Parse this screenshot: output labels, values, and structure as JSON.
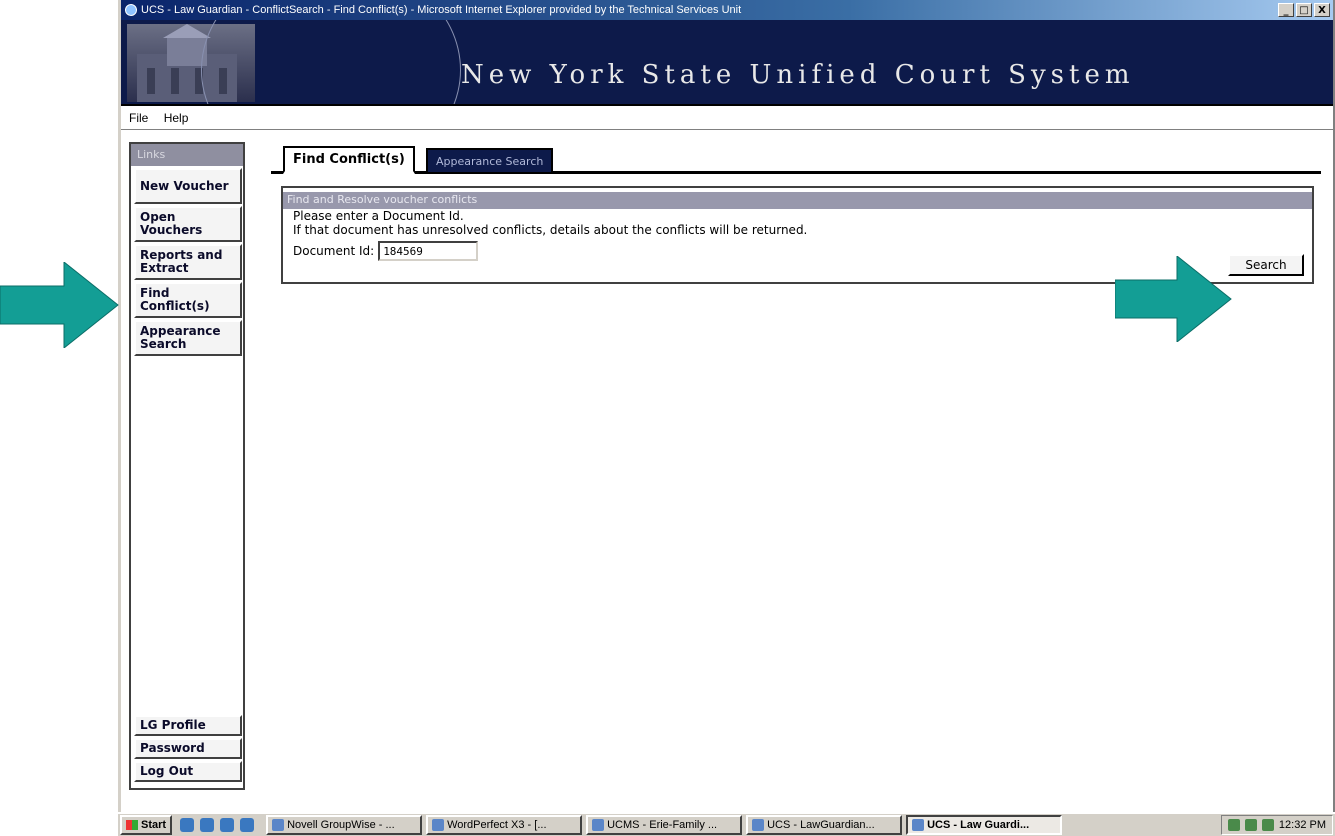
{
  "window": {
    "title": "UCS - Law Guardian - ConflictSearch - Find Conflict(s) - Microsoft Internet Explorer provided by the Technical Services Unit",
    "controls": [
      "_",
      "□",
      "X"
    ]
  },
  "banner": {
    "title": "New York State Unified Court System"
  },
  "menu": {
    "file": "File",
    "help": "Help"
  },
  "sidebar": {
    "header": "Links",
    "items": [
      {
        "label": "New Voucher"
      },
      {
        "label": "Open Vouchers"
      },
      {
        "label": "Reports and Extract"
      },
      {
        "label": "Find Conflict(s)"
      },
      {
        "label": "Appearance Search"
      }
    ],
    "bottom_items": [
      {
        "label": "LG Profile"
      },
      {
        "label": "Password"
      },
      {
        "label": "Log Out"
      }
    ]
  },
  "tabs": [
    {
      "label": "Find Conflict(s)",
      "active": true
    },
    {
      "label": "Appearance Search",
      "active": false
    }
  ],
  "panel": {
    "header": "Find and Resolve voucher conflicts",
    "line1": "Please enter a Document Id.",
    "line2": "If that document has unresolved conflicts, details about the conflicts will be returned.",
    "doc_label": "Document Id:",
    "doc_value": "184569",
    "search_label": "Search"
  },
  "annotations": {
    "arrow_color": "#139e95"
  },
  "taskbar": {
    "start": "Start",
    "tasks": [
      {
        "label": "Novell GroupWise - ..."
      },
      {
        "label": "WordPerfect X3 - [..."
      },
      {
        "label": "UCMS - Erie-Family ..."
      },
      {
        "label": "UCS - LawGuardian..."
      },
      {
        "label": "UCS - Law Guardi..."
      }
    ],
    "clock": "12:32 PM"
  }
}
